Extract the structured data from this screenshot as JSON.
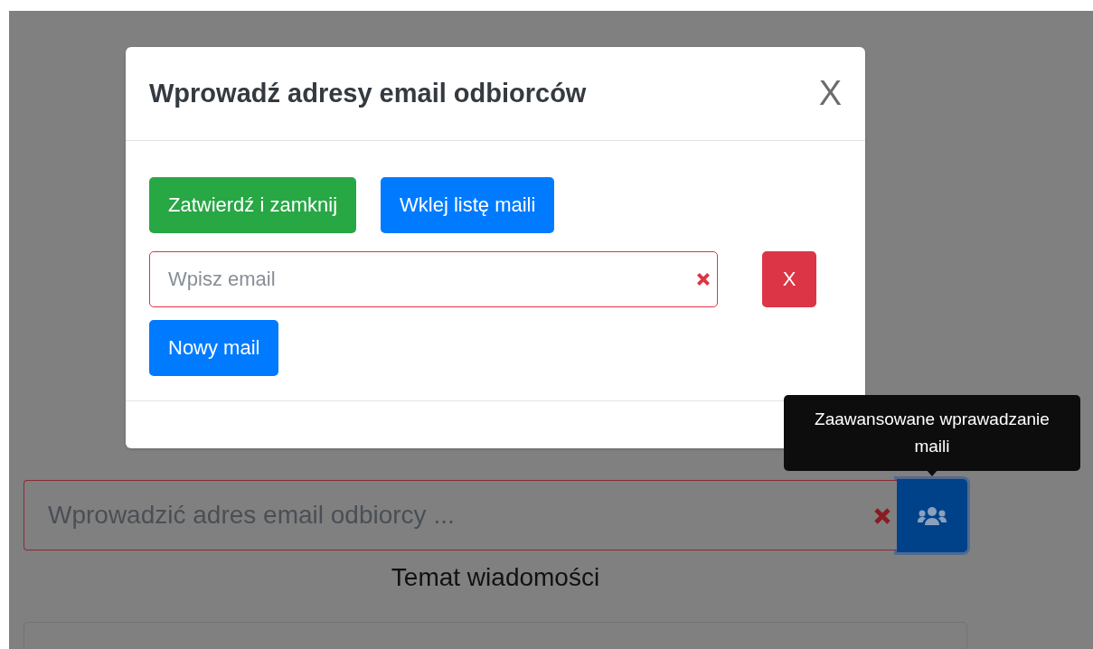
{
  "page": {
    "recipient_field": {
      "placeholder": "Wprowadzić adres email odbiorcy ...",
      "invalid": true
    },
    "subject_label": "Temat wiadomości"
  },
  "modal": {
    "title": "Wprowadź adresy email odbiorców",
    "close": "X",
    "buttons": [
      {
        "label": "Zatwierdź i zamknij",
        "kind": "success"
      },
      {
        "label": "Wklej listę maili",
        "kind": "primary"
      }
    ],
    "email_rows": [
      {
        "placeholder": "Wpisz email",
        "invalid": true,
        "remove": "X"
      }
    ],
    "add_button": "Nowy mail"
  },
  "tooltip": {
    "text": "Zaawansowane wprawadzanie maili"
  }
}
